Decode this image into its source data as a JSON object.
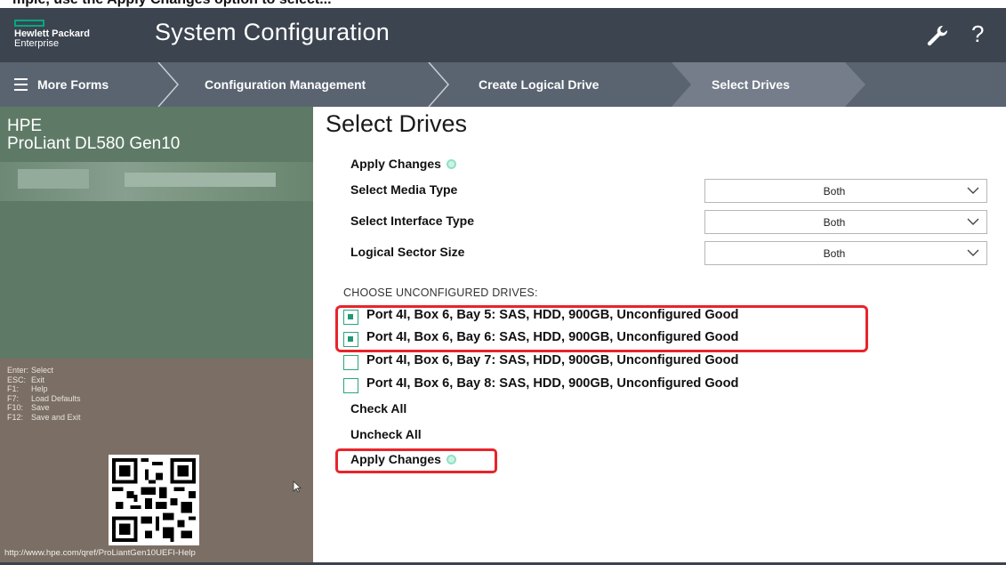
{
  "caption": "mple, use the Apply Changes option to select...",
  "header": {
    "logo_line1": "Hewlett Packard",
    "logo_line2": "Enterprise",
    "title": "System Configuration",
    "wrench_icon": "wrench-icon",
    "help_label": "?"
  },
  "breadcrumb": {
    "menu": "More Forms",
    "items": [
      "Configuration Management",
      "Create Logical Drive",
      "Select Drives"
    ]
  },
  "product": {
    "brand": "HPE",
    "model": "ProLiant DL580 Gen10"
  },
  "keys": [
    {
      "key": "Enter:",
      "action": "Select"
    },
    {
      "key": "ESC:",
      "action": "Exit"
    },
    {
      "key": "F1:",
      "action": "Help"
    },
    {
      "key": "F7:",
      "action": "Load Defaults"
    },
    {
      "key": "F10:",
      "action": "Save"
    },
    {
      "key": "F12:",
      "action": "Save and Exit"
    }
  ],
  "help_url": "http://www.hpe.com/qref/ProLiantGen10UEFI-Help",
  "page": {
    "title": "Select Drives",
    "apply_top": "Apply Changes",
    "fields": [
      {
        "label": "Select Media Type",
        "value": "Both"
      },
      {
        "label": "Select Interface Type",
        "value": "Both"
      },
      {
        "label": "Logical Sector Size",
        "value": "Both"
      }
    ],
    "section": "CHOOSE UNCONFIGURED DRIVES:",
    "drives": [
      {
        "label": "Port 4I, Box 6, Bay 5: SAS, HDD, 900GB, Unconfigured Good",
        "checked": true
      },
      {
        "label": "Port 4I, Box 6, Bay 6: SAS, HDD, 900GB, Unconfigured Good",
        "checked": true
      },
      {
        "label": "Port 4I, Box 6, Bay 7: SAS, HDD, 900GB, Unconfigured Good",
        "checked": false
      },
      {
        "label": "Port 4I, Box 6, Bay 8: SAS, HDD, 900GB, Unconfigured Good",
        "checked": false
      }
    ],
    "check_all": "Check All",
    "uncheck_all": "Uncheck All",
    "apply_bottom": "Apply Changes"
  },
  "colors": {
    "header_bg": "#3c4450",
    "breadcrumb_bg": "#5a6471",
    "accent": "#01a982",
    "left_top_bg": "#5e7a66",
    "left_bottom_bg": "#7b6f65",
    "highlight_red": "#e8242b"
  }
}
